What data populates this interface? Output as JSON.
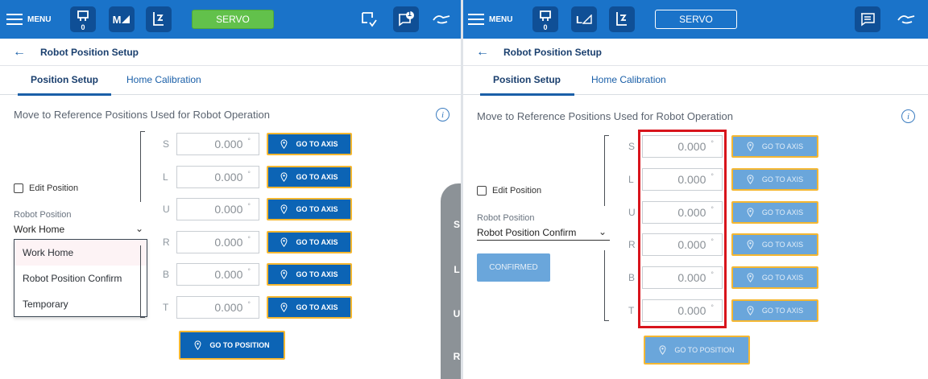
{
  "left": {
    "menu_label": "MENU",
    "toolbar": {
      "tool_badge": "0",
      "m_label": "M",
      "servo_label": "SERVO",
      "notification_count": "1"
    },
    "title": "Robot Position Setup",
    "tabs": [
      {
        "label": "Position Setup"
      },
      {
        "label": "Home Calibration"
      }
    ],
    "instruction": "Move to Reference Positions Used for Robot Operation",
    "info_glyph": "i",
    "edit_position_label": "Edit Position",
    "robot_position_label": "Robot Position",
    "robot_position_value": "Work Home",
    "dropdown_options": [
      "Work Home",
      "Robot Position Confirm",
      "Temporary"
    ],
    "axes": [
      {
        "label": "S",
        "value": "0.000",
        "unit": "°",
        "button": "GO TO AXIS"
      },
      {
        "label": "L",
        "value": "0.000",
        "unit": "°",
        "button": "GO TO AXIS"
      },
      {
        "label": "U",
        "value": "0.000",
        "unit": "°",
        "button": "GO TO AXIS"
      },
      {
        "label": "R",
        "value": "0.000",
        "unit": "°",
        "button": "GO TO AXIS"
      },
      {
        "label": "B",
        "value": "0.000",
        "unit": "°",
        "button": "GO TO AXIS"
      },
      {
        "label": "T",
        "value": "0.000",
        "unit": "°",
        "button": "GO TO AXIS"
      }
    ],
    "go_to_position": "GO TO POSITION",
    "side_rail": [
      "S",
      "L",
      "U",
      "R"
    ]
  },
  "right": {
    "menu_label": "MENU",
    "toolbar": {
      "tool_badge": "0",
      "l_label": "L",
      "servo_label": "SERVO"
    },
    "title": "Robot Position Setup",
    "tabs": [
      {
        "label": "Position Setup"
      },
      {
        "label": "Home Calibration"
      }
    ],
    "instruction": "Move to Reference Positions Used for Robot Operation",
    "info_glyph": "i",
    "edit_position_label": "Edit Position",
    "robot_position_label": "Robot Position",
    "robot_position_value": "Robot Position Confirm",
    "confirmed_label": "CONFIRMED",
    "axes": [
      {
        "label": "S",
        "value": "0.000",
        "unit": "°",
        "button": "GO TO AXIS"
      },
      {
        "label": "L",
        "value": "0.000",
        "unit": "°",
        "button": "GO TO AXIS"
      },
      {
        "label": "U",
        "value": "0.000",
        "unit": "°",
        "button": "GO TO AXIS"
      },
      {
        "label": "R",
        "value": "0.000",
        "unit": "°",
        "button": "GO TO AXIS"
      },
      {
        "label": "B",
        "value": "0.000",
        "unit": "°",
        "button": "GO TO AXIS"
      },
      {
        "label": "T",
        "value": "0.000",
        "unit": "°",
        "button": "GO TO AXIS"
      }
    ],
    "go_to_position": "GO TO POSITION"
  },
  "colors": {
    "topbar": "#1a73c9",
    "button_active": "#0c64b5",
    "button_disabled": "#6aa6db",
    "button_border": "#f5b731",
    "servo_on": "#62c14b",
    "highlight": "#d8141c"
  }
}
